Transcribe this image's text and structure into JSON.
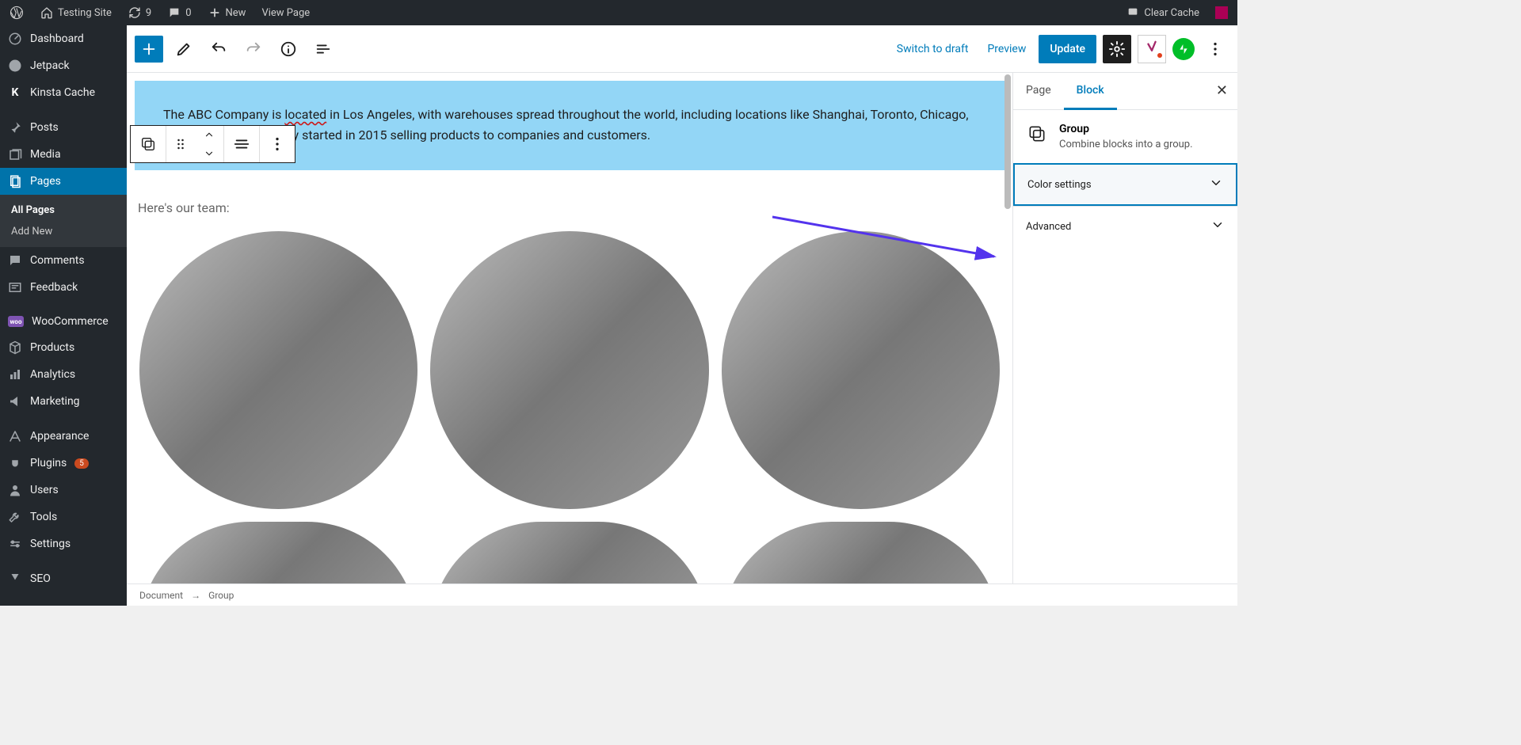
{
  "adminbar": {
    "site": "Testing Site",
    "updates": "9",
    "comments": "0",
    "new": "New",
    "viewpage": "View Page",
    "clearcache": "Clear Cache"
  },
  "leftnav": {
    "dashboard": "Dashboard",
    "jetpack": "Jetpack",
    "kinsta": "Kinsta Cache",
    "posts": "Posts",
    "media": "Media",
    "pages": "Pages",
    "allpages": "All Pages",
    "addnew": "Add New",
    "comments": "Comments",
    "feedback": "Feedback",
    "woo": "WooCommerce",
    "products": "Products",
    "analytics": "Analytics",
    "marketing": "Marketing",
    "appearance": "Appearance",
    "plugins": "Plugins",
    "plugins_count": "5",
    "users": "Users",
    "tools": "Tools",
    "settings": "Settings",
    "seo": "SEO"
  },
  "editor_top": {
    "switch": "Switch to draft",
    "preview": "Preview",
    "update": "Update"
  },
  "content": {
    "para_a": "The ABC Company is ",
    "para_located": "located",
    "para_b": " in Los Angeles, with warehouses spread throughout the world, including locations like Shanghai, Toronto, Chicago, and Paris. The company started in 2015 selling products to companies and customers.",
    "team": "Here's our team:"
  },
  "inspector": {
    "tab_page": "Page",
    "tab_block": "Block",
    "block_title": "Group",
    "block_desc": "Combine blocks into a group.",
    "color": "Color settings",
    "advanced": "Advanced"
  },
  "footer": {
    "doc": "Document",
    "group": "Group"
  }
}
